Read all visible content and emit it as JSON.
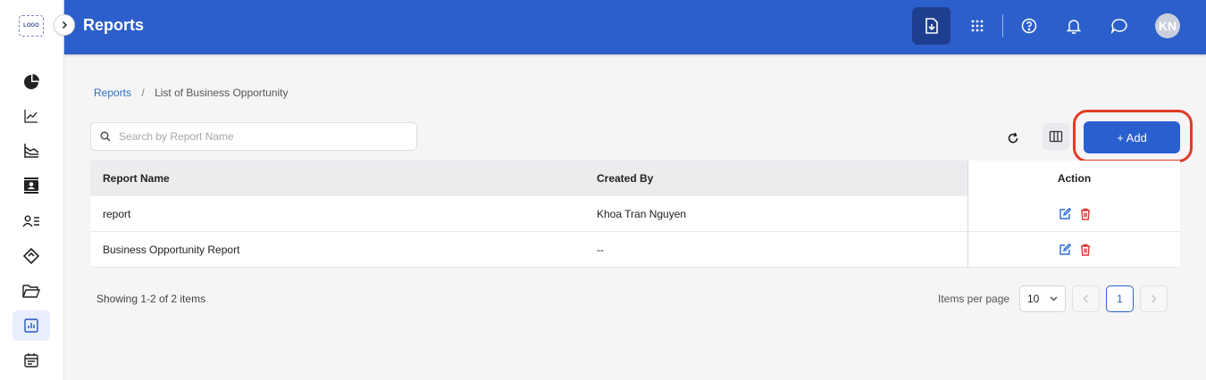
{
  "logo": "LOGO",
  "sidebar": {
    "items": [
      {
        "icon": "pie-chart-icon"
      },
      {
        "icon": "line-chart-icon"
      },
      {
        "icon": "area-chart-icon"
      },
      {
        "icon": "contact-card-icon"
      },
      {
        "icon": "user-list-icon"
      },
      {
        "icon": "tag-icon"
      },
      {
        "icon": "folder-icon"
      },
      {
        "icon": "report-icon",
        "active": true
      },
      {
        "icon": "calendar-icon"
      }
    ]
  },
  "header": {
    "title": "Reports",
    "avatar_initials": "KN"
  },
  "breadcrumb": {
    "root": "Reports",
    "separator": "/",
    "current": "List of Business Opportunity"
  },
  "search": {
    "placeholder": "Search by Report Name",
    "value": ""
  },
  "toolbar": {
    "add_label": "+ Add"
  },
  "table": {
    "columns": [
      "Report Name",
      "Created By",
      "Action"
    ],
    "rows": [
      {
        "name": "report",
        "created_by": "Khoa Tran Nguyen"
      },
      {
        "name": "Business Opportunity Report",
        "created_by": "--"
      }
    ]
  },
  "footer": {
    "showing": "Showing 1-2 of 2 items",
    "items_per_page_label": "Items per page",
    "items_per_page": "10",
    "current_page": "1"
  },
  "colors": {
    "header_bg": "#2c5fcb",
    "primary": "#2a5fd0",
    "highlight": "#e23b24",
    "edit": "#2c6fd6",
    "delete": "#d63a3a"
  }
}
